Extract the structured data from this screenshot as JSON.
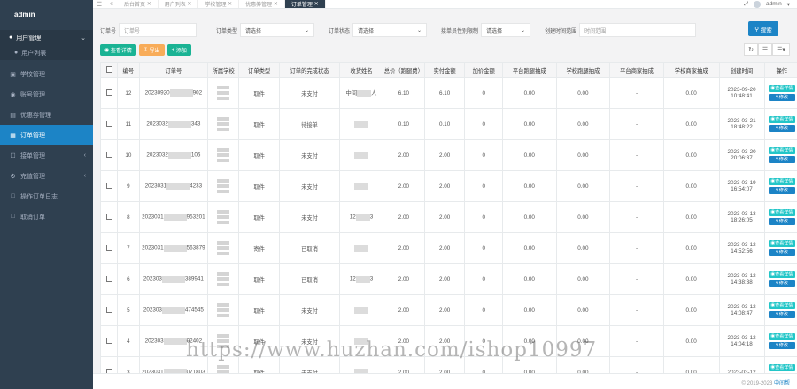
{
  "sidebar": {
    "brand": "admin",
    "user_menu": {
      "label": "用户管理",
      "child": "用户列表"
    },
    "items": [
      {
        "label": "学校管理",
        "icon": "school-icon"
      },
      {
        "label": "账号管理",
        "icon": "users-icon"
      },
      {
        "label": "优惠券管理",
        "icon": "coupon-icon"
      },
      {
        "label": "订单管理",
        "icon": "order-icon",
        "active": true
      },
      {
        "label": "接单管理",
        "icon": "task-icon",
        "arrow": true
      },
      {
        "label": "充值管理",
        "icon": "gear-icon",
        "arrow": true
      },
      {
        "label": "操作订单日志",
        "icon": "log-icon"
      },
      {
        "label": "取消订单",
        "icon": "cancel-icon"
      }
    ]
  },
  "topbar": {
    "tabs": [
      "后台首页",
      "用户列表",
      "学校管理",
      "优惠券管理",
      "订单管理"
    ],
    "active_tab": 4,
    "user": "admin"
  },
  "filters": {
    "order_no_label": "订单号",
    "order_no_placeholder": "订单号",
    "type_label": "订单类型",
    "type_value": "请选择",
    "status_label": "订单状态",
    "status_value": "请选择",
    "gender_label": "接单员性别限制",
    "gender_value": "请选择",
    "time_label": "创建时间范围",
    "time_placeholder": "时间范围",
    "search_label": "搜索"
  },
  "actions": {
    "detail": "查看详情",
    "export": "导出",
    "add": "添加"
  },
  "table": {
    "headers": [
      "编号",
      "订单号",
      "所属学校",
      "订单类型",
      "订单的完成状态",
      "收货姓名",
      "总价（跑腿费）",
      "实付金额",
      "加价金额",
      "平台跑腿抽成",
      "学校跑腿抽成",
      "平台商家抽成",
      "学校商家抽成",
      "创建时间",
      "操作"
    ],
    "view_label": "查看详情",
    "edit_label": "修改",
    "rows": [
      {
        "id": "12",
        "order": "20230920",
        "order_tail": "902",
        "type": "取件",
        "status": "未支付",
        "name_pre": "中间",
        "name_post": "人",
        "total": "6.10",
        "paid": "6.10",
        "markup": "0",
        "p_run": "0.00",
        "s_run": "0.00",
        "p_shop": "-",
        "s_shop": "0.00",
        "date": "2023-09-20",
        "time": "10:48:41"
      },
      {
        "id": "11",
        "order": "2023032",
        "order_tail": "343",
        "type": "取件",
        "status": "待接单",
        "name_pre": "",
        "name_post": "",
        "total": "0.10",
        "paid": "0.10",
        "markup": "0",
        "p_run": "0.00",
        "s_run": "0.00",
        "p_shop": "-",
        "s_shop": "0.00",
        "date": "2023-03-21",
        "time": "18:48:22"
      },
      {
        "id": "10",
        "order": "2023032",
        "order_tail": "106",
        "type": "取件",
        "status": "未支付",
        "name_pre": "",
        "name_post": "",
        "total": "2.00",
        "paid": "2.00",
        "markup": "0",
        "p_run": "0.00",
        "s_run": "0.00",
        "p_shop": "-",
        "s_shop": "0.00",
        "date": "2023-03-20",
        "time": "20:06:37"
      },
      {
        "id": "9",
        "order": "2023031",
        "order_tail": "4233",
        "type": "取件",
        "status": "未支付",
        "name_pre": "",
        "name_post": "",
        "total": "2.00",
        "paid": "2.00",
        "markup": "0",
        "p_run": "0.00",
        "s_run": "0.00",
        "p_shop": "-",
        "s_shop": "0.00",
        "date": "2023-03-19",
        "time": "16:54:07"
      },
      {
        "id": "8",
        "order": "2023031",
        "order_tail": "953201",
        "type": "取件",
        "status": "未支付",
        "name_pre": "12",
        "name_post": "3",
        "total": "2.00",
        "paid": "2.00",
        "markup": "0",
        "p_run": "0.00",
        "s_run": "0.00",
        "p_shop": "-",
        "s_shop": "0.00",
        "date": "2023-03-13",
        "time": "18:26:05"
      },
      {
        "id": "7",
        "order": "2023031",
        "order_tail": "563879",
        "type": "寄件",
        "status": "已取消",
        "name_pre": "",
        "name_post": "",
        "total": "2.00",
        "paid": "2.00",
        "markup": "0",
        "p_run": "0.00",
        "s_run": "0.00",
        "p_shop": "-",
        "s_shop": "0.00",
        "date": "2023-03-12",
        "time": "14:52:56"
      },
      {
        "id": "6",
        "order": "202303",
        "order_tail": "389941",
        "type": "取件",
        "status": "已取消",
        "name_pre": "12",
        "name_post": "3",
        "total": "2.00",
        "paid": "2.00",
        "markup": "0",
        "p_run": "0.00",
        "s_run": "0.00",
        "p_shop": "-",
        "s_shop": "0.00",
        "date": "2023-03-12",
        "time": "14:38:38"
      },
      {
        "id": "5",
        "order": "202303",
        "order_tail": "474545",
        "type": "取件",
        "status": "未支付",
        "name_pre": "",
        "name_post": "",
        "total": "2.00",
        "paid": "2.00",
        "markup": "0",
        "p_run": "0.00",
        "s_run": "0.00",
        "p_shop": "-",
        "s_shop": "0.00",
        "date": "2023-03-12",
        "time": "14:08:47"
      },
      {
        "id": "4",
        "order": "202303",
        "order_tail": "02402",
        "type": "取件",
        "status": "未支付",
        "name_pre": "",
        "name_post": "",
        "total": "2.00",
        "paid": "2.00",
        "markup": "0",
        "p_run": "0.00",
        "s_run": "0.00",
        "p_shop": "-",
        "s_shop": "0.00",
        "date": "2023-03-12",
        "time": "14:04:18"
      },
      {
        "id": "3",
        "order": "2023031",
        "order_tail": "071803",
        "type": "取件",
        "status": "未支付",
        "name_pre": "",
        "name_post": "",
        "total": "2.00",
        "paid": "2.00",
        "markup": "0",
        "p_run": "0.00",
        "s_run": "0.00",
        "p_shop": "-",
        "s_shop": "0.00",
        "date": "2023-03-12",
        "time": ""
      }
    ]
  },
  "footer": {
    "copyright": "© 2019-2023",
    "link": "中间帮"
  },
  "watermark": "https://www.huzhan.com/ishop10997",
  "colors": {
    "sidebar": "#2f4050",
    "accent": "#1c84c6",
    "teal": "#1ab394",
    "orange": "#f8ac59",
    "cyan": "#23c6c8"
  }
}
